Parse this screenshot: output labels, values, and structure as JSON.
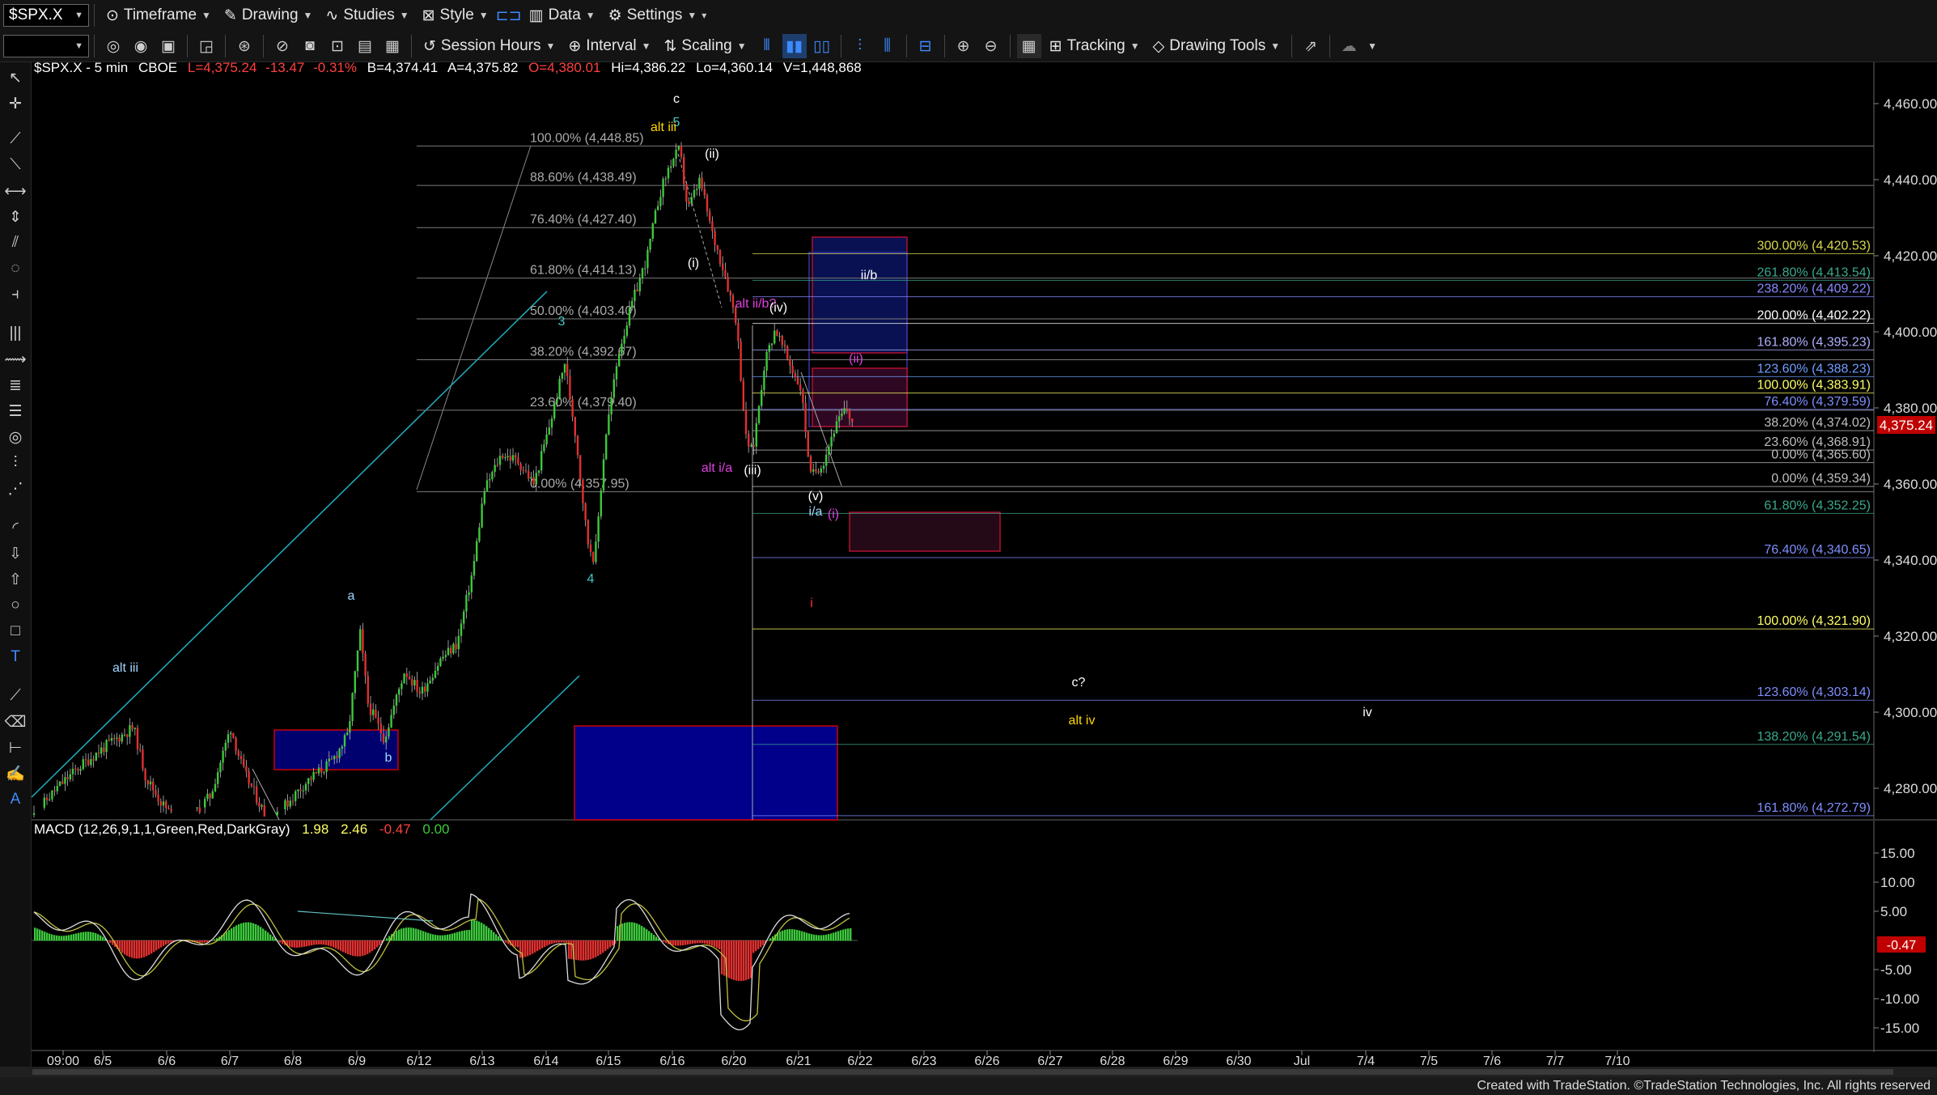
{
  "toolbar": {
    "symbol": "$SPX.X",
    "timeframe": "Timeframe",
    "drawing": "Drawing",
    "studies": "Studies",
    "style": "Style",
    "data": "Data",
    "settings": "Settings",
    "session_hours": "Session Hours",
    "interval": "Interval",
    "scaling": "Scaling",
    "tracking": "Tracking",
    "drawing_tools": "Drawing Tools"
  },
  "header": {
    "symbol_interval": "$SPX.X - 5 min",
    "exchange": "CBOE",
    "last": "L=4,375.24",
    "change": "-13.47",
    "change_pct": "-0.31%",
    "bid": "B=4,374.41",
    "ask": "A=4,375.82",
    "open": "O=4,380.01",
    "high": "Hi=4,386.22",
    "low": "Lo=4,360.14",
    "volume": "V=1,448,868"
  },
  "price_axis": {
    "labels": [
      "4,460.00",
      "4,440.00",
      "4,420.00",
      "4,400.00",
      "4,380.00",
      "4,360.00",
      "4,340.00",
      "4,320.00",
      "4,300.00",
      "4,280.00"
    ],
    "current_price": "4,375.24",
    "current_color": "#c00000"
  },
  "macd": {
    "label": "MACD (12,26,9,1,1,Green,Red,DarkGray)",
    "v1": "1.98",
    "v2": "2.46",
    "v3": "-0.47",
    "v4": "0.00",
    "axis": [
      "15.00",
      "10.00",
      "5.00",
      "-5.00",
      "-10.00",
      "-15.00"
    ],
    "current": "-0.47"
  },
  "time_axis": [
    "09:00",
    "6/5",
    "6/6",
    "6/7",
    "6/8",
    "6/9",
    "6/12",
    "6/13",
    "6/14",
    "6/15",
    "6/16",
    "6/20",
    "6/21",
    "6/22",
    "6/23",
    "6/26",
    "6/27",
    "6/28",
    "6/29",
    "6/30",
    "Jul",
    "7/4",
    "7/5",
    "7/6",
    "7/7",
    "7/10"
  ],
  "fib_left": [
    {
      "label": "100.00% (4,448.85)",
      "price": 4448.85
    },
    {
      "label": "88.60% (4,438.49)",
      "price": 4438.49
    },
    {
      "label": "76.40% (4,427.40)",
      "price": 4427.4
    },
    {
      "label": "61.80% (4,414.13)",
      "price": 4414.13
    },
    {
      "label": "50.00% (4,403.40)",
      "price": 4403.4
    },
    {
      "label": "38.20% (4,392.67)",
      "price": 4392.67
    },
    {
      "label": "23.60% (4,379.40)",
      "price": 4379.4
    },
    {
      "label": "0.00% (4,357.95)",
      "price": 4357.95
    }
  ],
  "fib_right": [
    {
      "label": "300.00% (4,420.53)",
      "price": 4420.53,
      "color": "#d8d84a"
    },
    {
      "label": "261.80% (4,413.54)",
      "price": 4413.54,
      "color": "#3aa88c"
    },
    {
      "label": "238.20% (4,409.22)",
      "price": 4409.22,
      "color": "#8a8aff"
    },
    {
      "label": "200.00% (4,402.22)",
      "price": 4402.22,
      "color": "#ffffff"
    },
    {
      "label": "161.80% (4,395.23)",
      "price": 4395.23,
      "color": "#b0b0ff"
    },
    {
      "label": "123.60% (4,388.23)",
      "price": 4388.23,
      "color": "#6f9fff"
    },
    {
      "label": "100.00% (4,383.91)",
      "price": 4383.91,
      "color": "#ffff66"
    },
    {
      "label": "76.40% (4,379.59)",
      "price": 4379.59,
      "color": "#7f8fff"
    },
    {
      "label": "38.20% (4,374.02)",
      "price": 4374.02,
      "color": "#bfbfbf"
    },
    {
      "label": "23.60% (4,368.91)",
      "price": 4368.91,
      "color": "#bfbfbf"
    },
    {
      "label": "0.00% (4,365.60)",
      "price": 4365.6,
      "color": "#bfbfbf"
    },
    {
      "label": "0.00% (4,359.34)",
      "price": 4359.34,
      "color": "#bfbfbf"
    },
    {
      "label": "61.80% (4,352.25)",
      "price": 4352.25,
      "color": "#3aa88c"
    },
    {
      "label": "76.40% (4,340.65)",
      "price": 4340.65,
      "color": "#7f8fff"
    },
    {
      "label": "100.00% (4,321.90)",
      "price": 4321.9,
      "color": "#ffff66"
    },
    {
      "label": "123.60% (4,303.14)",
      "price": 4303.14,
      "color": "#7f8fff"
    },
    {
      "label": "138.20% (4,291.54)",
      "price": 4291.54,
      "color": "#3aa88c"
    },
    {
      "label": "161.80% (4,272.79)",
      "price": 4272.79,
      "color": "#7f8fff"
    }
  ],
  "wave_labels": [
    {
      "text": "alt iii",
      "color": "#9fd6ff"
    },
    {
      "text": "a",
      "color": "#9fd6ff"
    },
    {
      "text": "b",
      "color": "#9fd6ff"
    },
    {
      "text": "3",
      "color": "#40c8c8"
    },
    {
      "text": "4",
      "color": "#40c8c8"
    },
    {
      "text": "c",
      "color": "#ffffff"
    },
    {
      "text": "5",
      "color": "#40c8c8"
    },
    {
      "text": "alt iii",
      "color": "#ffd700"
    },
    {
      "text": "(ii)",
      "color": "#ffffff"
    },
    {
      "text": "(i)",
      "color": "#ffffff"
    },
    {
      "text": "alt ii/b?",
      "color": "#e040e0"
    },
    {
      "text": "(iv)",
      "color": "#ffffff"
    },
    {
      "text": "ii/b",
      "color": "#ffffff"
    },
    {
      "text": "(ii)",
      "color": "#e040e0"
    },
    {
      "text": "alt i/a",
      "color": "#e040e0"
    },
    {
      "text": "(iii)",
      "color": "#ffffff"
    },
    {
      "text": "(v)",
      "color": "#ffffff"
    },
    {
      "text": "i/a",
      "color": "#9fd6ff"
    },
    {
      "text": "(i)",
      "color": "#e040e0"
    },
    {
      "text": "i",
      "color": "#ff3030"
    },
    {
      "text": "c?",
      "color": "#ffffff"
    },
    {
      "text": "alt iv",
      "color": "#ffd700"
    },
    {
      "text": "iv",
      "color": "#ffffff"
    }
  ],
  "footer": "Created with TradeStation. ©TradeStation Technologies, Inc. All rights reserved"
}
